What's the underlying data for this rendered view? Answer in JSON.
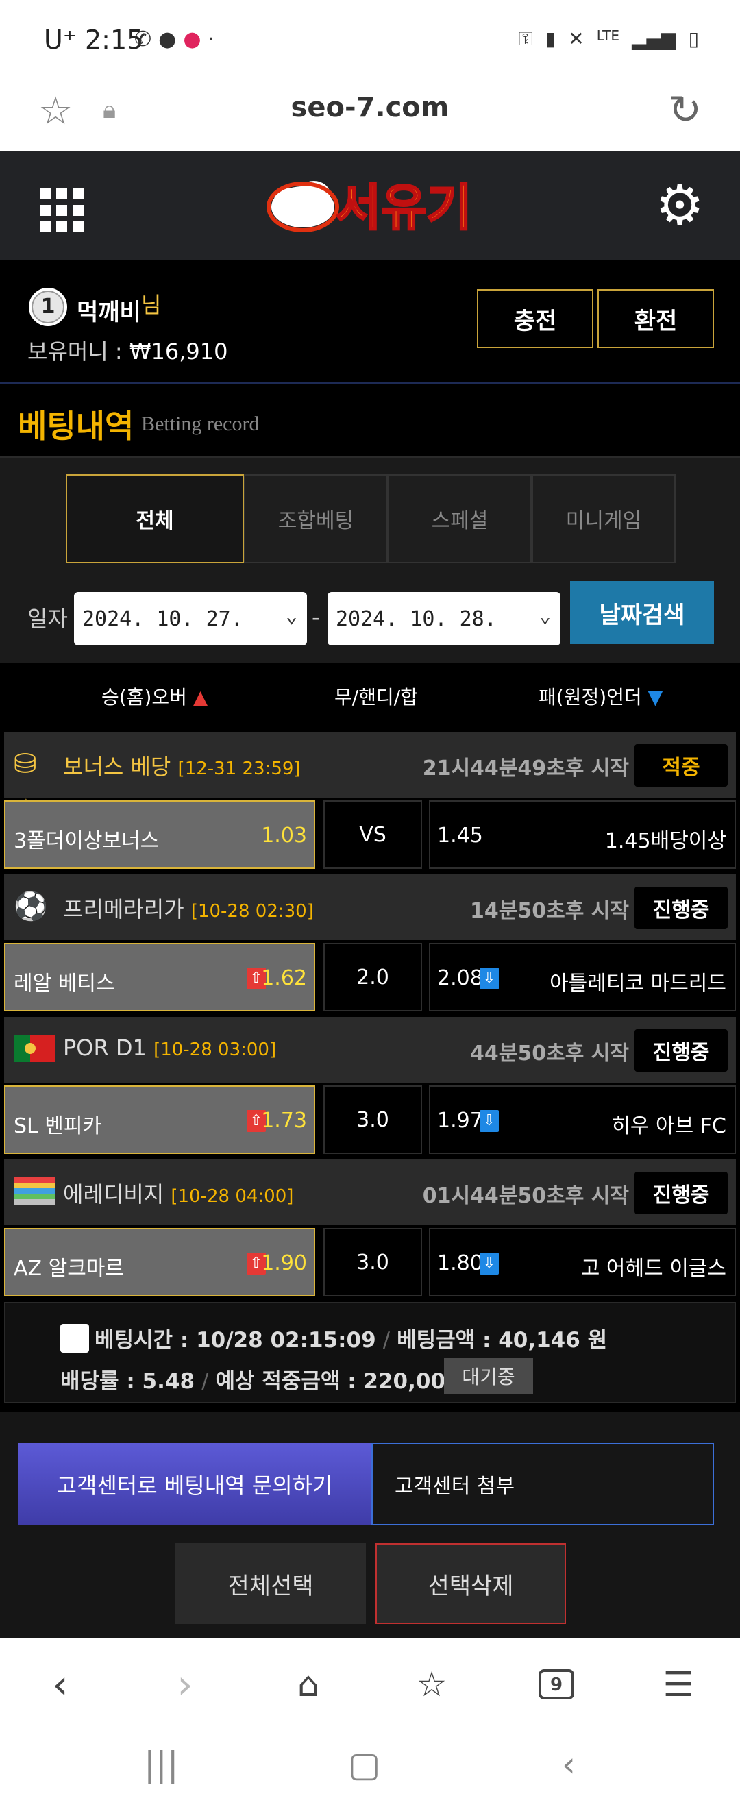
{
  "status_bar": {
    "carrier": "U⁺",
    "time": "2:15",
    "network": "LTE"
  },
  "url_bar": {
    "url": "seo-7.com"
  },
  "site": {
    "logo_text": "서유기"
  },
  "user": {
    "level": "1",
    "name": "먹깨비",
    "honorific": "님",
    "money_label": "보유머니 : ",
    "money_value": "₩16,910",
    "charge_button": "충전",
    "exchange_button": "환전"
  },
  "page_title": {
    "title": "베팅내역",
    "subtitle": "Betting record"
  },
  "tabs": [
    {
      "label": "전체",
      "active": true
    },
    {
      "label": "조합베팅",
      "active": false
    },
    {
      "label": "스페셜",
      "active": false
    },
    {
      "label": "미니게임",
      "active": false
    }
  ],
  "date_filter": {
    "label": "일자",
    "start": "2024. 10. 27.",
    "end": "2024. 10. 28.",
    "search_button": "날짜검색"
  },
  "columns": {
    "home": "승(홈)오버",
    "draw": "무/핸디/합",
    "away": "패(원정)언더"
  },
  "games": [
    {
      "league": "보너스 베당",
      "datetime": "[12-31 23:59]",
      "start_text": "21시44분49초후 시작",
      "status": "적중",
      "home_team": "3폴더이상보너스",
      "home_odds": "1.03",
      "home_up": false,
      "mid": "VS",
      "away_odds": "1.45",
      "away_down": false,
      "away_team": "1.45배당이상"
    },
    {
      "league": "프리메라리가",
      "datetime": "[10-28 02:30]",
      "start_text": "14분50초후 시작",
      "status": "진행중",
      "home_team": "레알 베티스",
      "home_odds": "1.62",
      "home_up": true,
      "mid": "2.0",
      "away_odds": "2.08",
      "away_down": true,
      "away_team": "아틀레티코 마드리드"
    },
    {
      "league": "POR D1",
      "datetime": "[10-28 03:00]",
      "start_text": "44분50초후 시작",
      "status": "진행중",
      "home_team": "SL 벤피카",
      "home_odds": "1.73",
      "home_up": true,
      "mid": "3.0",
      "away_odds": "1.97",
      "away_down": true,
      "away_team": "히우 아브 FC"
    },
    {
      "league": "에레디비지",
      "datetime": "[10-28 04:00]",
      "start_text": "01시44분50초후 시작",
      "status": "진행중",
      "home_team": "AZ 알크마르",
      "home_odds": "1.90",
      "home_up": true,
      "mid": "3.0",
      "away_odds": "1.80",
      "away_down": true,
      "away_team": "고 어헤드 이글스"
    }
  ],
  "summary": {
    "bet_time_label": "베팅시간 : ",
    "bet_time": "10/28 02:15:09",
    "bet_amount_label": "베팅금액 : ",
    "bet_amount": "40,146 원",
    "odds_label": "배당률 : ",
    "odds": "5.48",
    "expected_label": "예상 적중금액 : ",
    "expected": "220,000 원",
    "status": "대기중"
  },
  "actions": {
    "inquiry": "고객센터로 베팅내역 문의하기",
    "attach": "고객센터 첨부",
    "select_all": "전체선택",
    "delete_selected": "선택삭제"
  },
  "browser_nav": {
    "tab_count": "9"
  },
  "colors": {
    "gold": "#c9a43a",
    "accent_yellow": "#f4b400",
    "search_blue": "#1e79a8",
    "inquiry_purple": "#4f4cc4"
  }
}
